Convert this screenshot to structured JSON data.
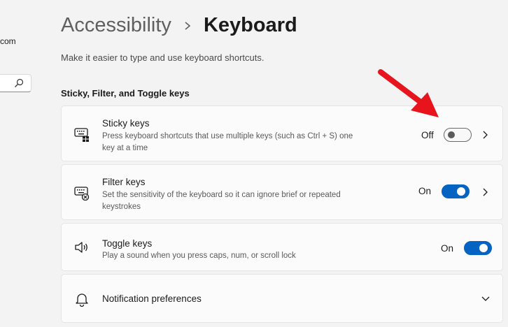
{
  "sidebar": {
    "account_email_fragment": "com",
    "search_icon": "search-icon"
  },
  "header": {
    "breadcrumb_parent": "Accessibility",
    "breadcrumb_separator_icon": "chevron-right-icon",
    "breadcrumb_current": "Keyboard",
    "description": "Make it easier to type and use keyboard shortcuts."
  },
  "section": {
    "title": "Sticky, Filter, and Toggle keys"
  },
  "settings": {
    "sticky_keys": {
      "icon": "keyboard-sticky-icon",
      "title": "Sticky keys",
      "description": "Press keyboard shortcuts that use multiple keys (such as Ctrl + S) one key at a time",
      "state_label": "Off",
      "enabled": false
    },
    "filter_keys": {
      "icon": "keyboard-filter-icon",
      "title": "Filter keys",
      "description": "Set the sensitivity of the keyboard so it can ignore brief or repeated keystrokes",
      "state_label": "On",
      "enabled": true
    },
    "toggle_keys": {
      "icon": "speaker-icon",
      "title": "Toggle keys",
      "description": "Play a sound when you press caps, num, or scroll lock",
      "state_label": "On",
      "enabled": true
    },
    "notification_preferences": {
      "icon": "bell-icon",
      "title": "Notification preferences"
    }
  },
  "colors": {
    "accent": "#0563c1",
    "annotation_arrow": "#e8141d",
    "background": "#f3f3f3",
    "card": "#fbfbfb"
  }
}
